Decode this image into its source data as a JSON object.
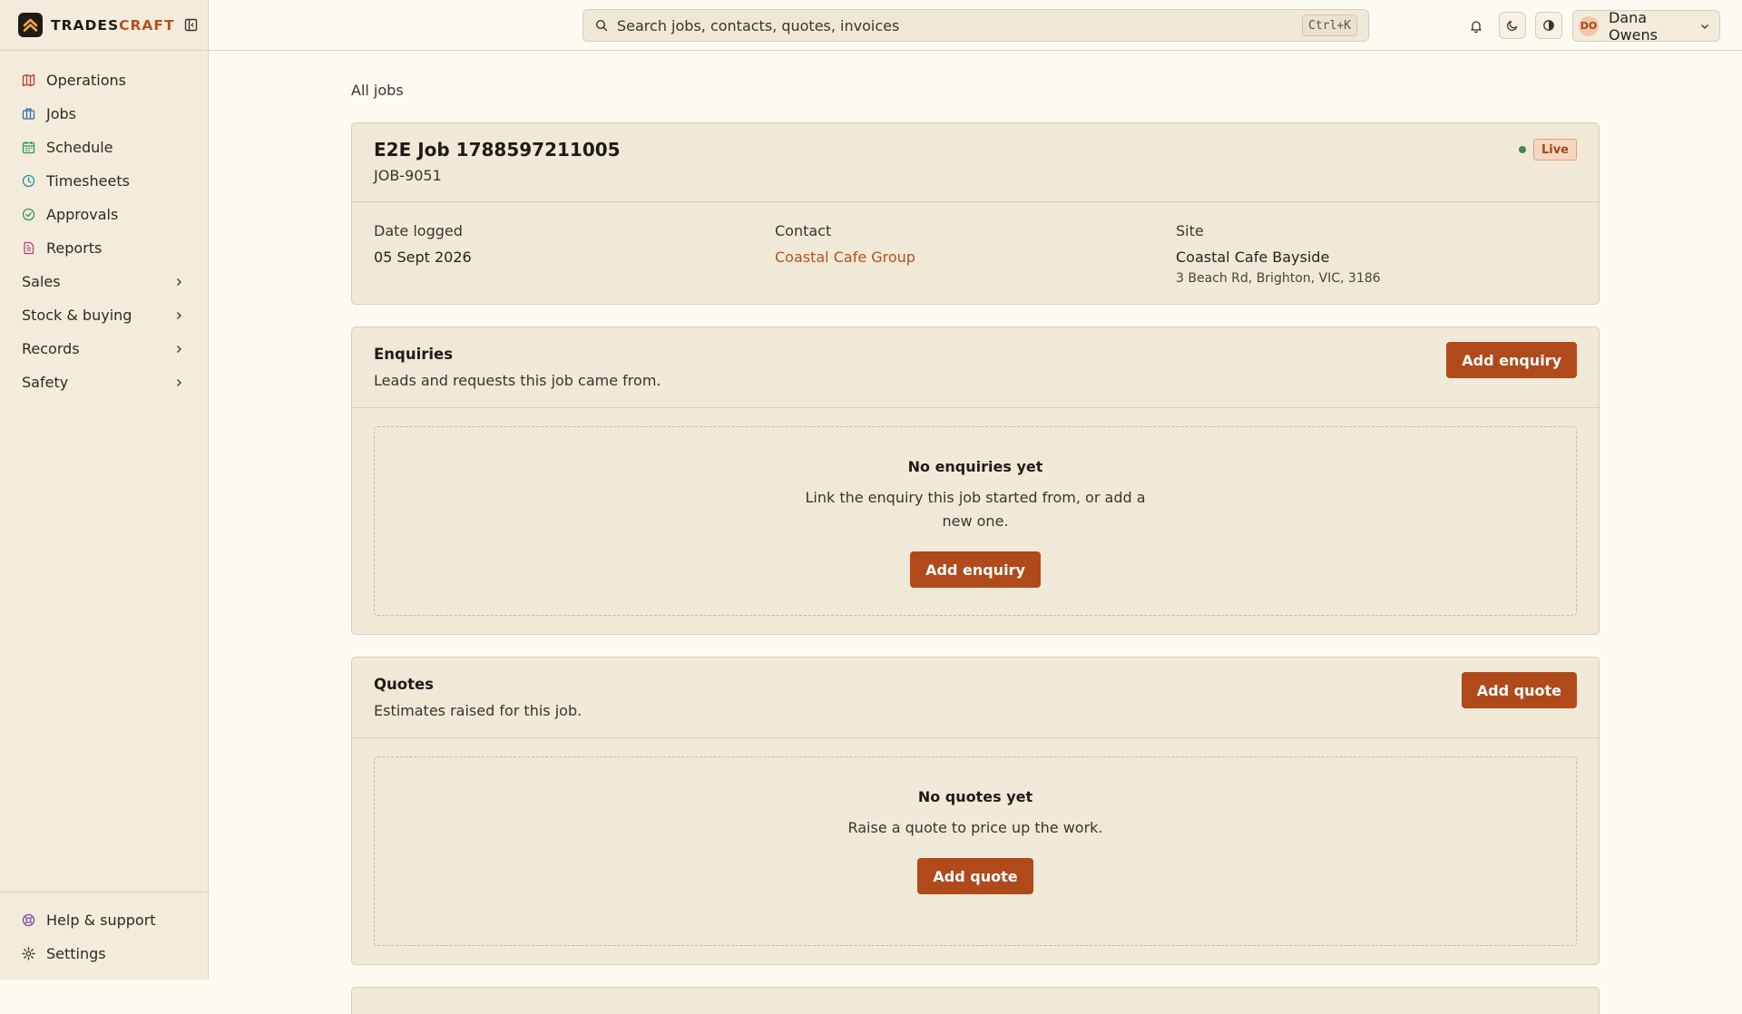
{
  "app": {
    "brand_left": "TRADES",
    "brand_right": "CRAFT",
    "accent_color": "#b04a1a"
  },
  "sidebar": {
    "items": [
      {
        "label": "Operations",
        "icon": "map-icon",
        "color": "#c0392b"
      },
      {
        "label": "Jobs",
        "icon": "briefcase-icon",
        "color": "#2f6db5"
      },
      {
        "label": "Schedule",
        "icon": "calendar-icon",
        "color": "#2e9a5a"
      },
      {
        "label": "Timesheets",
        "icon": "clock-icon",
        "color": "#1f8fa8"
      },
      {
        "label": "Approvals",
        "icon": "check-circle-icon",
        "color": "#2e9a5a"
      },
      {
        "label": "Reports",
        "icon": "report-icon",
        "color": "#b2447a"
      }
    ],
    "groups": [
      {
        "label": "Sales"
      },
      {
        "label": "Stock & buying"
      },
      {
        "label": "Records"
      },
      {
        "label": "Safety"
      }
    ],
    "footer": [
      {
        "label": "Help & support",
        "icon": "help-ring-icon"
      },
      {
        "label": "Settings",
        "icon": "gear-icon"
      }
    ]
  },
  "topbar": {
    "search_placeholder": "Search jobs, contacts, quotes, invoices",
    "search_shortcut": "Ctrl+K",
    "user_initials": "DO",
    "user_name": "Dana Owens"
  },
  "page": {
    "breadcrumb": "All jobs",
    "job": {
      "title": "E2E Job 1788597211005",
      "number": "JOB-9051",
      "status": "Live",
      "date_label": "Date logged",
      "date_value": "05 Sept 2026",
      "contact_label": "Contact",
      "contact_value": "Coastal Cafe Group",
      "site_label": "Site",
      "site_name": "Coastal Cafe Bayside",
      "site_address": "3 Beach Rd, Brighton, VIC, 3186"
    },
    "enquiries": {
      "title": "Enquiries",
      "description": "Leads and requests this job came from.",
      "add_label": "Add enquiry",
      "empty_title": "No enquiries yet",
      "empty_text": "Link the enquiry this job started from, or add a new one.",
      "empty_button": "Add enquiry"
    },
    "quotes": {
      "title": "Quotes",
      "description": "Estimates raised for this job.",
      "add_label": "Add quote",
      "empty_title": "No quotes yet",
      "empty_text": "Raise a quote to price up the work.",
      "empty_button": "Add quote"
    }
  }
}
